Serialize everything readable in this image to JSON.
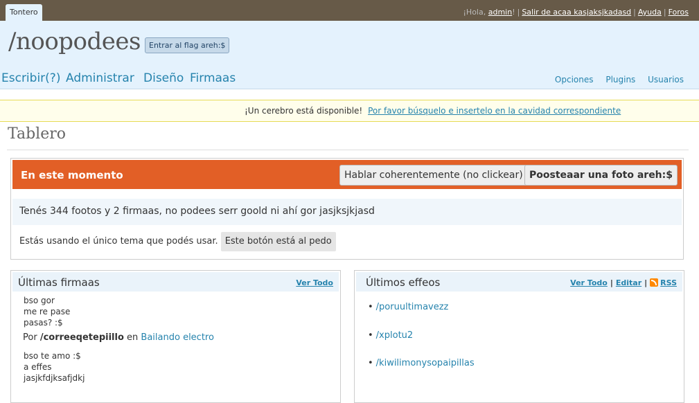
{
  "topbar": {
    "blog_tab": "Tontero",
    "greeting": "¡Hola, ",
    "username": "admin",
    "greeting_end": "!",
    "logout": "Salir de acaa kasjaksjkadasd",
    "help": "Ayuda",
    "forums": "Foros"
  },
  "header": {
    "site_title": "/noopodees",
    "flag_button": "Entrar al flag areh:$",
    "main_nav": [
      "Escribir(?)",
      "Administrar",
      "Diseño",
      "Firmaas"
    ],
    "sub_nav": [
      "Opciones",
      "Plugins",
      "Usuarios"
    ]
  },
  "notice": {
    "text": "¡Un cerebro está disponible!",
    "link": "Por favor búsquelo e insertelo en la cavidad correspondiente"
  },
  "page_title": "Tablero",
  "right_now": {
    "title": "En este momento",
    "button_talk": "Hablar coherentemente (no clickear)",
    "button_post": "Poosteaar una foto areh:$",
    "summary": "Tenés 344 footos y 2 firmaas, no podees serr goold ni ahí gor jasjksjkjasd",
    "theme_text": "Estás usando el único tema que podés usar.",
    "theme_button": "Este botón está al pedo"
  },
  "recent_comments": {
    "title": "Últimas firmaas",
    "view_all": "Ver Todo",
    "comment1": "bso gor\nme re pase\npasas? :$",
    "by_prefix": "Por",
    "author": "/correeqetepiillo",
    "in_word": "en",
    "post": "Bailando electro",
    "comment2": "bso te amo :$\na effes\njasjkfdjksafjdkj"
  },
  "recent_feeds": {
    "title": "Últimos effeos",
    "view_all": "Ver Todo",
    "edit": "Editar",
    "rss": "RSS",
    "items": [
      "/poruultimavezz",
      "/xplotu2",
      "/kiwilimonysopaipillas"
    ]
  },
  "colors": {
    "topbar": "#675a48",
    "header": "#e4f2fd",
    "right_now_header": "#e25f26",
    "link": "#2583ad"
  }
}
